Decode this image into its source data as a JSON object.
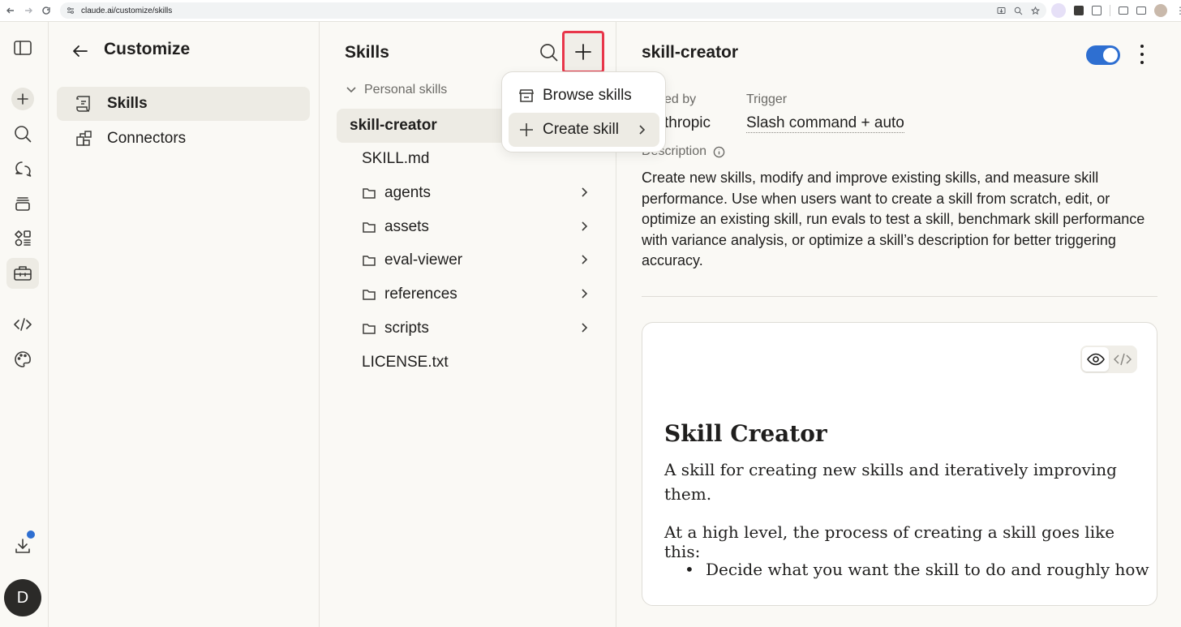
{
  "browser": {
    "url": "claude.ai/customize/skills"
  },
  "rail": {
    "avatar_initial": "D"
  },
  "customize": {
    "title": "Customize",
    "nav": [
      {
        "label": "Skills",
        "icon": "skills-icon"
      },
      {
        "label": "Connectors",
        "icon": "connectors-icon"
      }
    ]
  },
  "skills_panel": {
    "title": "Skills",
    "section_label": "Personal skills",
    "selected_skill": "skill-creator",
    "files": [
      {
        "label": "SKILL.md",
        "type": "file"
      },
      {
        "label": "agents",
        "type": "folder"
      },
      {
        "label": "assets",
        "type": "folder"
      },
      {
        "label": "eval-viewer",
        "type": "folder"
      },
      {
        "label": "references",
        "type": "folder"
      },
      {
        "label": "scripts",
        "type": "folder"
      },
      {
        "label": "LICENSE.txt",
        "type": "file"
      }
    ]
  },
  "dropdown": {
    "items": [
      {
        "label": "Browse skills",
        "icon": "store-icon"
      },
      {
        "label": "Create skill",
        "icon": "plus-icon"
      }
    ]
  },
  "detail": {
    "title": "skill-creator",
    "added_by_label": "ed by",
    "added_by_value": "thropic",
    "trigger_label": "Trigger",
    "trigger_value": "Slash command + auto",
    "description_label": "Description",
    "description": "Create new skills, modify and improve existing skills, and measure skill performance. Use when users want to create a skill from scratch, edit, or optimize an existing skill, run evals to test a skill, benchmark skill performance with variance analysis, or optimize a skill’s description for better triggering accuracy.",
    "preview": {
      "heading": "Skill Creator",
      "paragraph1": "A skill for creating new skills and iteratively improving them.",
      "paragraph2": "At a high level, the process of creating a skill goes like this:",
      "bullet1": "Decide what you want the skill to do and roughly how"
    },
    "toggle_on": true
  },
  "colors": {
    "accent_blue": "#2e6fd1",
    "highlight_red": "#e8364a",
    "background": "#faf9f5"
  }
}
